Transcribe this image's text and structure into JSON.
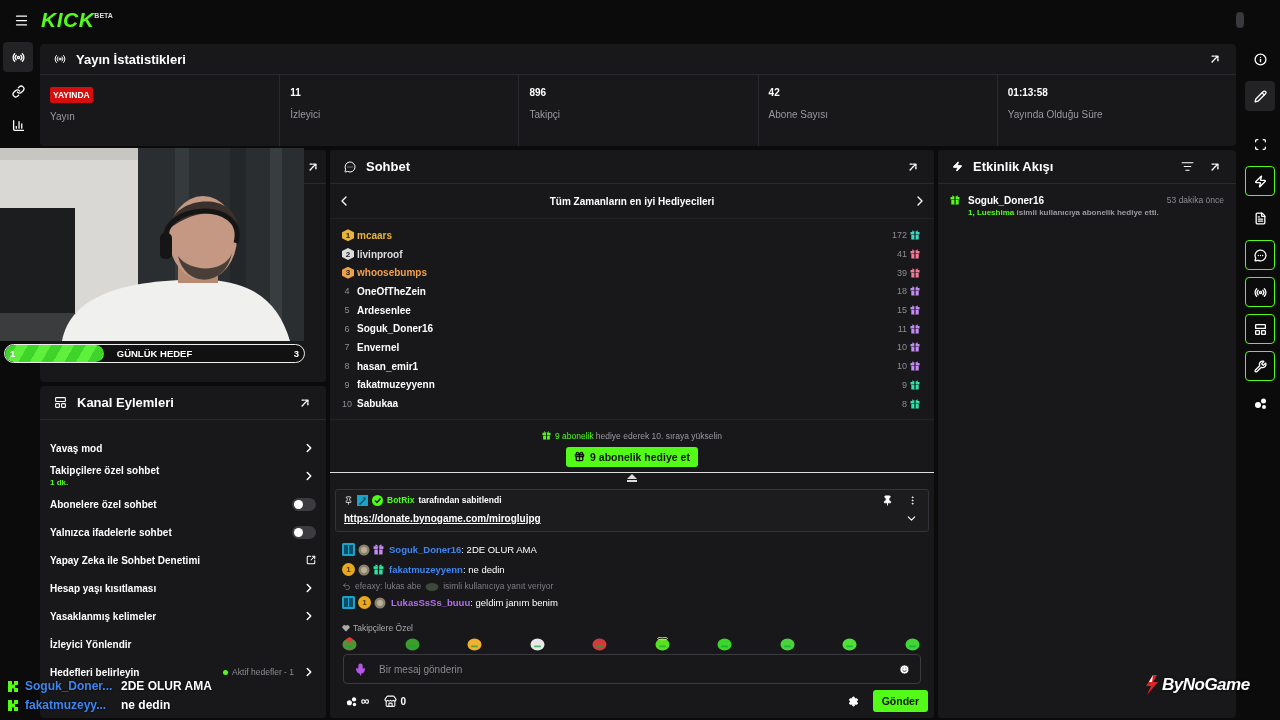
{
  "topbar": {
    "logo": "KICK",
    "logo_badge": "BETA"
  },
  "left_rail": [
    {
      "kind": "broadcast",
      "selected": true
    },
    {
      "kind": "link",
      "selected": false
    },
    {
      "kind": "stats",
      "selected": false
    }
  ],
  "right_rail": [
    {
      "kind": "info",
      "selected": false,
      "on": false
    },
    {
      "kind": "edit",
      "selected": true,
      "on": false
    },
    {
      "kind": "scan",
      "selected": false,
      "on": false
    },
    {
      "kind": "activity",
      "selected": false,
      "on": true
    },
    {
      "kind": "notes",
      "selected": false,
      "on": false
    },
    {
      "kind": "chat",
      "selected": false,
      "on": true
    },
    {
      "kind": "broadcast",
      "selected": false,
      "on": true
    },
    {
      "kind": "layout",
      "selected": false,
      "on": true
    },
    {
      "kind": "tools",
      "selected": false,
      "on": true
    },
    {
      "kind": "more",
      "selected": false,
      "on": false
    }
  ],
  "stats": {
    "title": "Yayın İstatistikleri",
    "cells": [
      {
        "kind": "badge",
        "value": "YAYINDA",
        "label": "Yayın"
      },
      {
        "kind": "number",
        "value": "11",
        "label": "İzleyici"
      },
      {
        "kind": "number",
        "value": "896",
        "label": "Takipçi"
      },
      {
        "kind": "number",
        "value": "42",
        "label": "Abone Sayısı"
      },
      {
        "kind": "number",
        "value": "01:13:58",
        "label": "Yayında Olduğu Süre"
      }
    ]
  },
  "webcam": {
    "kind": "picture",
    "goal": {
      "start": "1",
      "label": "GÜNLÜK HEDEF",
      "end": "3",
      "level": 0.33
    }
  },
  "channel_actions": {
    "title": "Kanal Eylemleri",
    "rows": [
      {
        "kind": "chevron",
        "label": "Yavaş mod"
      },
      {
        "kind": "chevron",
        "label": "Takipçilere özel sohbet",
        "note": "1 dk."
      },
      {
        "kind": "toggle",
        "label": "Abonelere özel sohbet",
        "on": false
      },
      {
        "kind": "toggle",
        "label": "Yalnızca ifadelerle sohbet",
        "on": false
      },
      {
        "kind": "external",
        "label": "Yapay Zeka ile Sohbet Denetimi"
      },
      {
        "kind": "chevron",
        "label": "Hesap yaşı kısıtlaması"
      },
      {
        "kind": "chevron",
        "label": "Yasaklanmış kelimeler"
      },
      {
        "kind": "plain",
        "label": "İzleyici Yönlendir"
      },
      {
        "kind": "chevron",
        "label": "Hedefleri belirleyin",
        "status": "Aktif hedefler - 1"
      }
    ]
  },
  "chat": {
    "title": "Sohbet",
    "leaderboard": {
      "title": "Tüm Zamanların en iyi Hediyecileri",
      "rows": [
        {
          "kind": "medal",
          "rank": "1",
          "color": "#e8b53a",
          "name": "mcaars",
          "count": "172",
          "gift": {
            "color": "#3fd9c2"
          }
        },
        {
          "kind": "medal",
          "rank": "2",
          "color": "#dcdcdc",
          "name": "livinproof",
          "count": "41",
          "gift": {
            "color": "#f27a96"
          }
        },
        {
          "kind": "medal",
          "rank": "3",
          "color": "#f0a04b",
          "name": "whoosebumps",
          "count": "39",
          "gift": {
            "color": "#f27a96"
          }
        },
        {
          "kind": "plain",
          "rank": "4",
          "name": "OneOfTheZein",
          "count": "18",
          "gift": {
            "color": "#c58af5"
          }
        },
        {
          "kind": "plain",
          "rank": "5",
          "name": "Ardesenlee",
          "count": "15",
          "gift": {
            "color": "#c58af5"
          }
        },
        {
          "kind": "plain",
          "rank": "6",
          "name": "Soguk_Doner16",
          "count": "11",
          "gift": {
            "color": "#c58af5"
          }
        },
        {
          "kind": "plain",
          "rank": "7",
          "name": "Envernel",
          "count": "10",
          "gift": {
            "color": "#c58af5"
          }
        },
        {
          "kind": "plain",
          "rank": "8",
          "name": "hasan_emir1",
          "count": "10",
          "gift": {
            "color": "#c58af5"
          }
        },
        {
          "kind": "plain",
          "rank": "9",
          "name": "fakatmuzeyyenn",
          "count": "9",
          "gift": {
            "color": "#2fe3a6"
          }
        },
        {
          "kind": "plain",
          "rank": "10",
          "name": "Sabukaa",
          "count": "8",
          "gift": {
            "color": "#2fe3a6"
          }
        }
      ]
    },
    "promo": {
      "text": "**9 abonelik** hediye ederek 10. sıraya yükselin",
      "button": "9 abonelik hediye et"
    },
    "pinned": {
      "by": "BotRix",
      "note": "tarafından sabitlendi",
      "link": "https://donate.bynogame.com/miroglujpg"
    },
    "messages": [
      {
        "badges": [
          {
            "kind": "og"
          },
          {
            "kind": "rank"
          },
          {
            "kind": "gift",
            "color": "#c58af5"
          }
        ],
        "user": "Soguk_Doner16",
        "color": "#3f86f0",
        "separator": ":",
        "text": "2DE OLUR AMA"
      },
      {
        "badges": [
          {
            "kind": "coin",
            "text": "1"
          },
          {
            "kind": "rank"
          },
          {
            "kind": "gift",
            "color": "#2fe3a6"
          }
        ],
        "user": "fakatmuzeyyenn",
        "color": "#3f86f0",
        "separator": ":",
        "text": "ne dedin"
      },
      {
        "reply": {
          "to": "efeaxy: lukas abe",
          "note": "isimli kullanıcıya yanıt veriyor"
        },
        "badges": [
          {
            "kind": "og"
          },
          {
            "kind": "coin",
            "text": "1"
          },
          {
            "kind": "rank"
          }
        ],
        "user": "LukasSsSs_buuu",
        "color": "#b46cf2",
        "separator": ":",
        "text": "geldim janım benim"
      }
    ],
    "emote_set": "Takipçilere Özel",
    "input": {
      "placeholder": "Bir mesaj gönderin"
    },
    "footer": {
      "infinity": "∞",
      "points": "0",
      "send": "Gönder"
    }
  },
  "events": {
    "title": "Etkinlik Akışı",
    "items": [
      {
        "user": "Soguk_Doner16",
        "time": "53 dakika önce",
        "text": "**1, Lueshima** isimli kullanıcıya abonelik hediye etti."
      }
    ]
  },
  "stream_overlay": {
    "messages": [
      {
        "user": "Soguk_Doner...",
        "text": "2DE OLUR AMA"
      },
      {
        "user": "fakatmuzeyy...",
        "text": "ne dedin"
      }
    ]
  },
  "sponsor_logo": "ByNoGame"
}
